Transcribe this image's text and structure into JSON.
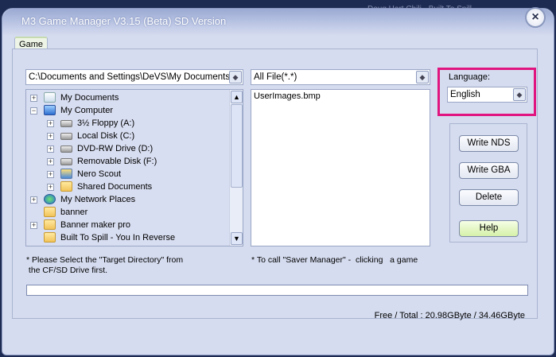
{
  "background_text": "Doug Hart Chili - Built To Spill",
  "window": {
    "title": "M3 Game Manager V3.15 (Beta)  SD Version",
    "close_label": "×"
  },
  "tab": {
    "label": "Game"
  },
  "path_combo": {
    "value": "C:\\Documents and Settings\\DeVS\\My Documents"
  },
  "filter_combo": {
    "value": "All File(*.*)"
  },
  "tree": [
    {
      "label": "My Documents",
      "level": 0,
      "exp": "+",
      "icon": "docs"
    },
    {
      "label": "My Computer",
      "level": 0,
      "exp": "−",
      "icon": "comp"
    },
    {
      "label": "3½ Floppy (A:)",
      "level": 1,
      "exp": "+",
      "icon": "drive"
    },
    {
      "label": "Local Disk (C:)",
      "level": 1,
      "exp": "+",
      "icon": "drive"
    },
    {
      "label": "DVD-RW Drive (D:)",
      "level": 1,
      "exp": "+",
      "icon": "drive"
    },
    {
      "label": "Removable Disk (F:)",
      "level": 1,
      "exp": "+",
      "icon": "drive"
    },
    {
      "label": "Nero Scout",
      "level": 1,
      "exp": "+",
      "icon": "scout"
    },
    {
      "label": "Shared Documents",
      "level": 1,
      "exp": "+",
      "icon": "folder"
    },
    {
      "label": "My Network Places",
      "level": 0,
      "exp": "+",
      "icon": "net"
    },
    {
      "label": "banner",
      "level": 0,
      "exp": "",
      "icon": "folder"
    },
    {
      "label": "Banner maker pro",
      "level": 0,
      "exp": "+",
      "icon": "folder"
    },
    {
      "label": "Built To Spill - You In Reverse",
      "level": 0,
      "exp": "",
      "icon": "folder"
    }
  ],
  "files": [
    "UserImages.bmp"
  ],
  "language": {
    "label": "Language:",
    "value": "English"
  },
  "buttons": {
    "write_nds": "Write NDS",
    "write_gba": "Write GBA",
    "delete": "Delete",
    "help": "Help"
  },
  "notes": {
    "left_line1": "* Please Select the \"Target Directory\" from",
    "left_line2": " the CF/SD Drive first.",
    "right": "* To call \"Saver Manager\" -  clicking   a game"
  },
  "progress": {
    "percent": 0
  },
  "status": {
    "free_total": "Free / Total : 20.98GByte / 34.46GByte"
  },
  "colors": {
    "highlight": "#e0157f"
  }
}
